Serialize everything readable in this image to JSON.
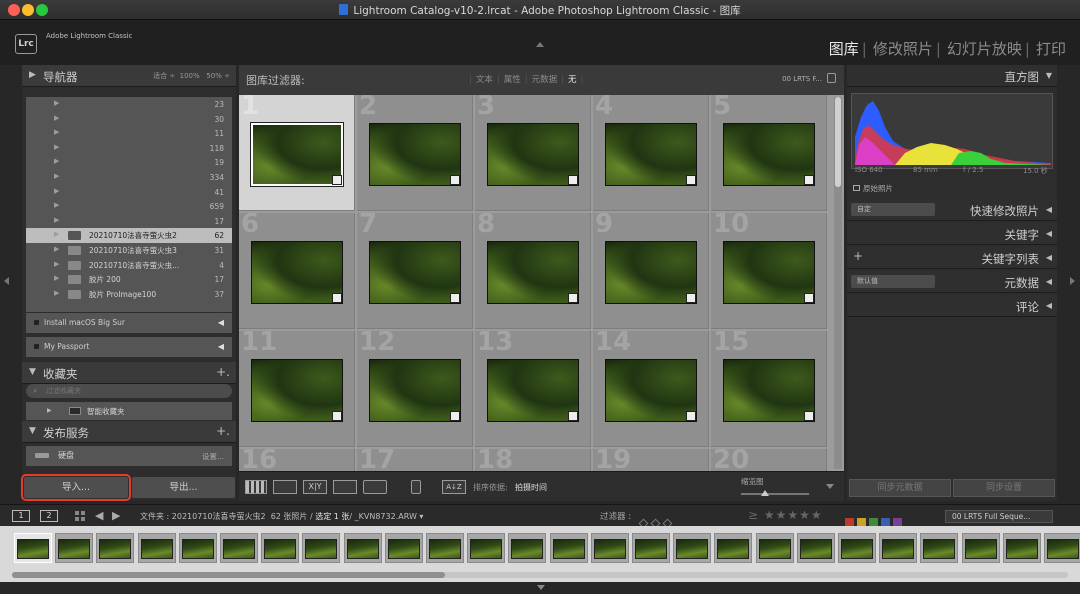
{
  "window": {
    "title": "Lightroom Catalog-v10-2.lrcat - Adobe Photoshop Lightroom Classic - 图库"
  },
  "identity": {
    "logo": "Lrc",
    "app_name": "Adobe Lightroom Classic"
  },
  "modules": [
    {
      "label": "图库",
      "active": true
    },
    {
      "label": "修改照片",
      "active": false
    },
    {
      "label": "幻灯片放映",
      "active": false
    },
    {
      "label": "打印",
      "active": false
    }
  ],
  "navigator": {
    "title": "导航器",
    "options": [
      "适合",
      "100%",
      "50%"
    ]
  },
  "folders": [
    {
      "name": "",
      "count": "23"
    },
    {
      "name": "",
      "count": "30"
    },
    {
      "name": "",
      "count": "11"
    },
    {
      "name": "",
      "count": "118"
    },
    {
      "name": "",
      "count": "19"
    },
    {
      "name": "",
      "count": "334"
    },
    {
      "name": "",
      "count": "41"
    },
    {
      "name": "",
      "count": "659"
    },
    {
      "name": "",
      "count": "17"
    },
    {
      "name": "20210710法喜寺萤火虫2",
      "count": "62",
      "selected": true
    },
    {
      "name": "20210710法喜寺萤火虫3",
      "count": "31"
    },
    {
      "name": "20210710法喜寺萤火虫...",
      "count": "4"
    },
    {
      "name": "胶片 200",
      "count": "17"
    },
    {
      "name": "胶片 ProImage100",
      "count": "37"
    }
  ],
  "volumes": [
    {
      "name": "Install macOS Big Sur"
    },
    {
      "name": "My Passport"
    }
  ],
  "collections": {
    "title": "收藏夹",
    "search_placeholder": "过滤收藏夹",
    "smart": "智能收藏夹"
  },
  "publish": {
    "title": "发布服务",
    "disk": "硬盘",
    "setup": "设置..."
  },
  "import_label": "导入...",
  "export_label": "导出...",
  "filter": {
    "label": "图库过滤器:",
    "options": [
      {
        "label": "文本",
        "on": false
      },
      {
        "label": "属性",
        "on": false
      },
      {
        "label": "元数据",
        "on": false
      },
      {
        "label": "无",
        "on": true
      }
    ],
    "preset": "00 LRTS F..."
  },
  "grid": {
    "numbers": [
      "1",
      "2",
      "3",
      "4",
      "5",
      "6",
      "7",
      "8",
      "9",
      "10",
      "11",
      "12",
      "13",
      "14",
      "15",
      "16",
      "17",
      "18",
      "19",
      "20"
    ],
    "selected_index": 0
  },
  "toolbar": {
    "sort_label": "排序依据:",
    "sort_value": "拍摄时间",
    "thumb_label": "缩览图",
    "thumb_level": 0.35
  },
  "right": {
    "histogram_title": "直方图",
    "exif": {
      "iso": "ISO 640",
      "focal": "85 mm",
      "aperture": "f / 2.5",
      "shutter": "15.0 秒"
    },
    "original_photo": "原始照片",
    "quick_develop": {
      "title": "快速修改照片",
      "preset": "自定"
    },
    "keywords": "关键字",
    "keyword_list": "关键字列表",
    "metadata": {
      "title": "元数据",
      "preset": "默认值"
    },
    "comments": "评论",
    "sync_metadata": "同步元数据",
    "sync_settings": "同步设置"
  },
  "filmstrip": {
    "screen1": "1",
    "screen2": "2",
    "source_prefix": "文件夹 : 20210710法喜寺萤火虫2",
    "photo_count": "62 张照片 /",
    "selected": "选定 1 张",
    "filename": "/ _KVN8732.ARW ▾",
    "filter_label": "过滤器 :",
    "stars_prefix": "≥",
    "preset": "00 LRTS Full Seque...",
    "colors": [
      "#c0392b",
      "#c9a227",
      "#3c8a3c",
      "#3a5fb0",
      "#7a3f9a"
    ],
    "thumb_count": 26,
    "scroll_fraction": 0.41
  },
  "histogram_colors": {
    "red": "#e0373f",
    "green": "#3ccf3c",
    "blue": "#2f5cff",
    "yellow": "#e8e23a",
    "magenta": "#e040e0",
    "cyan": "#3ad0e0"
  }
}
